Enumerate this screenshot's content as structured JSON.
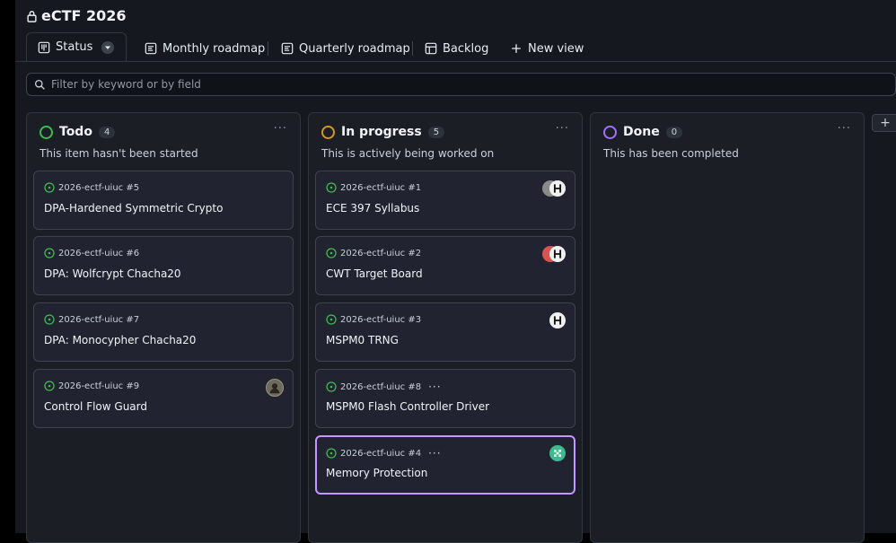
{
  "project": {
    "title": "eCTF 2026"
  },
  "tabs": [
    {
      "label": "Status",
      "icon": "board-icon",
      "active": true
    },
    {
      "label": "Monthly roadmap",
      "icon": "roadmap-icon"
    },
    {
      "label": "Quarterly roadmap",
      "icon": "roadmap-icon"
    },
    {
      "label": "Backlog",
      "icon": "table-icon"
    },
    {
      "label": "New view",
      "icon": "plus-icon"
    }
  ],
  "filter": {
    "placeholder": "Filter by keyword or by field"
  },
  "columns": [
    {
      "name": "Todo",
      "count": "4",
      "description": "This item hasn't been started",
      "color": "#3fb950",
      "cards": [
        {
          "ref": "2026-ectf-uiuc #5",
          "title": "DPA-Hardened Symmetric Crypto"
        },
        {
          "ref": "2026-ectf-uiuc #6",
          "title": "DPA: Wolfcrypt Chacha20"
        },
        {
          "ref": "2026-ectf-uiuc #7",
          "title": "DPA: Monocypher Chacha20"
        },
        {
          "ref": "2026-ectf-uiuc #9",
          "title": "Control Flow Guard",
          "avatar": "user-avatar"
        }
      ]
    },
    {
      "name": "In progress",
      "count": "5",
      "description": "This is actively being worked on",
      "color": "#d29922",
      "cards": [
        {
          "ref": "2026-ectf-uiuc #1",
          "title": "ECE 397 Syllabus",
          "avatar": "group-avatar"
        },
        {
          "ref": "2026-ectf-uiuc #2",
          "title": "CWT Target Board",
          "avatar": "group-avatar"
        },
        {
          "ref": "2026-ectf-uiuc #3",
          "title": "MSPM0 TRNG",
          "avatar": "user-avatar"
        },
        {
          "ref": "2026-ectf-uiuc #8",
          "title": "MSPM0 Flash Controller Driver",
          "dots": "···"
        },
        {
          "ref": "2026-ectf-uiuc #4",
          "title": "Memory Protection",
          "dots": "···",
          "avatar": "user-avatar"
        }
      ]
    },
    {
      "name": "Done",
      "count": "0",
      "description": "This has been completed",
      "color": "#a371f7",
      "cards": []
    }
  ],
  "ui": {
    "more": "···",
    "add_column": "+"
  }
}
